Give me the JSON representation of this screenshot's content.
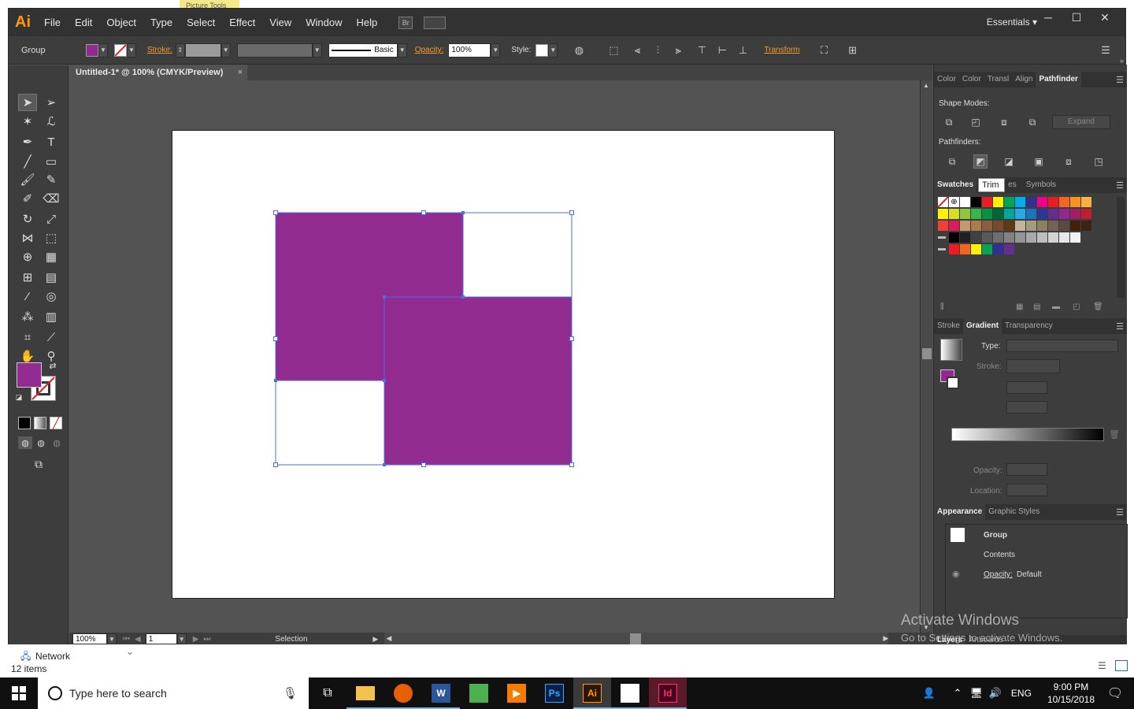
{
  "app": {
    "logo": "Ai",
    "menu": [
      "File",
      "Edit",
      "Object",
      "Type",
      "Select",
      "Effect",
      "View",
      "Window",
      "Help"
    ],
    "bridge_label": "Br",
    "workspace": "Essentials",
    "workspace_arrow": "▾",
    "window_controls": [
      "─",
      "☐",
      "✕"
    ]
  },
  "picture_tools_tab": "Picture Tools",
  "control_bar": {
    "selection_type": "Group",
    "fill_color": "#922b8f",
    "stroke_link": "Stroke:",
    "brush_label": "Basic",
    "opacity_link": "Opacity:",
    "opacity_value": "100%",
    "style_label": "Style:",
    "transform_link": "Transform"
  },
  "document": {
    "tab_title": "Untitled-1* @ 100% (CMYK/Preview)",
    "close": "×",
    "artwork_color": "#922b8f",
    "selection_color": "#4a6fe0"
  },
  "status_bar": {
    "zoom": "100%",
    "artboard": "1",
    "tool_status": "Selection"
  },
  "panels": {
    "top_tabs": [
      "Color",
      "Color",
      "Transl",
      "Align",
      "Pathfinder"
    ],
    "top_active": "Pathfinder",
    "shape_modes_label": "Shape Modes:",
    "expand_label": "Expand",
    "pathfinders_label": "Pathfinders:",
    "tooltip": "Trim",
    "swatch_tabs": [
      "Swatches",
      "es",
      "Symbols"
    ],
    "gradient_tabs": [
      "Stroke",
      "Gradient",
      "Transparency"
    ],
    "gradient": {
      "type_label": "Type:",
      "stroke_label": "Stroke:",
      "opacity_label": "Opacity:",
      "location_label": "Location:"
    },
    "appearance_tabs": [
      "Appearance",
      "Graphic Styles"
    ],
    "appearance_rows": [
      "Group",
      "Contents"
    ],
    "appearance_opacity_link": "Opacity:",
    "appearance_opacity_value": "Default",
    "bottom_tabs": [
      "Layers",
      "Artboards"
    ]
  },
  "watermark": {
    "line1": "Activate Windows",
    "line2": "Go to Settings to activate Windows."
  },
  "explorer": {
    "network_label": "Network",
    "items_count": "12 items"
  },
  "taskbar": {
    "search_placeholder": "Type here to search",
    "time": "9:00 PM",
    "date": "10/15/2018",
    "language": "ENG",
    "apps": [
      "task-view",
      "file-explorer",
      "firefox",
      "word",
      "sheets",
      "media-player",
      "photoshop",
      "illustrator",
      "photos",
      "indesign"
    ],
    "ps_label": "Ps",
    "ai_label": "Ai",
    "id_label": "Id",
    "word_label": "W"
  }
}
